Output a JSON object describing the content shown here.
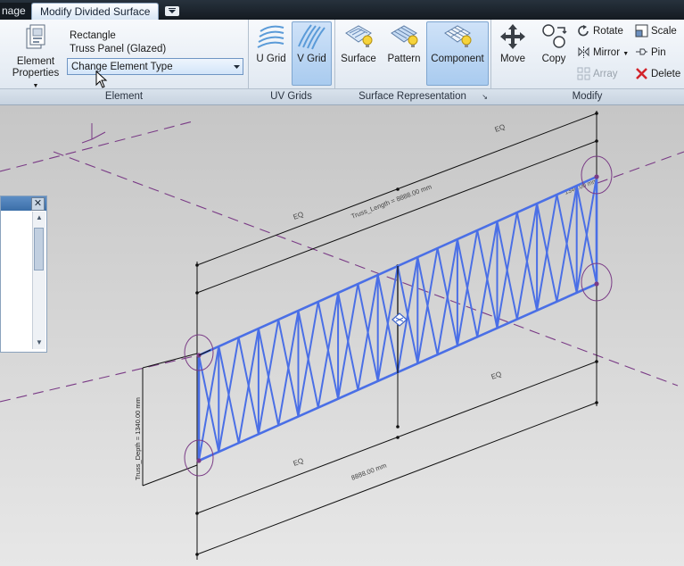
{
  "tabs": {
    "previous_label": "nage",
    "active_label": "Modify Divided Surface"
  },
  "ribbon": {
    "element_panel": {
      "properties_label_line1": "Element",
      "properties_label_line2": "Properties",
      "family_name": "Rectangle",
      "type_name": "Truss Panel (Glazed)",
      "change_type_value": "Change Element Type",
      "panel_label": "Element"
    },
    "uv_panel": {
      "u_grid_label": "U Grid",
      "v_grid_label": "V Grid",
      "panel_label": "UV Grids"
    },
    "surface_panel": {
      "surface_label": "Surface",
      "pattern_label": "Pattern",
      "component_label": "Component",
      "panel_label": "Surface Representation"
    },
    "modify_panel": {
      "move_label": "Move",
      "copy_label": "Copy",
      "rotate_label": "Rotate",
      "mirror_label": "Mirror",
      "array_label": "Array",
      "scale_label": "Scale",
      "pin_label": "Pin",
      "delete_label": "Delete",
      "panel_label": "Modify"
    }
  },
  "canvas": {
    "eq_top": "EQ",
    "eq_mid": "EQ",
    "eq_bottom": "EQ",
    "eq_bottom_left": "EQ",
    "truss_length_label": "Truss_Length = 8888.00 mm",
    "truss_depth_label": "Truss_Depth = 1340.00 mm",
    "bottom_dim_label": "8888.00 mm",
    "corner_dim_label": "1340.00 mm"
  },
  "colors": {
    "truss": "#4a6fe6",
    "dimension": "#111111",
    "reference_plane": "#7a3b86",
    "ribbon_accent": "#3b6ea8"
  }
}
